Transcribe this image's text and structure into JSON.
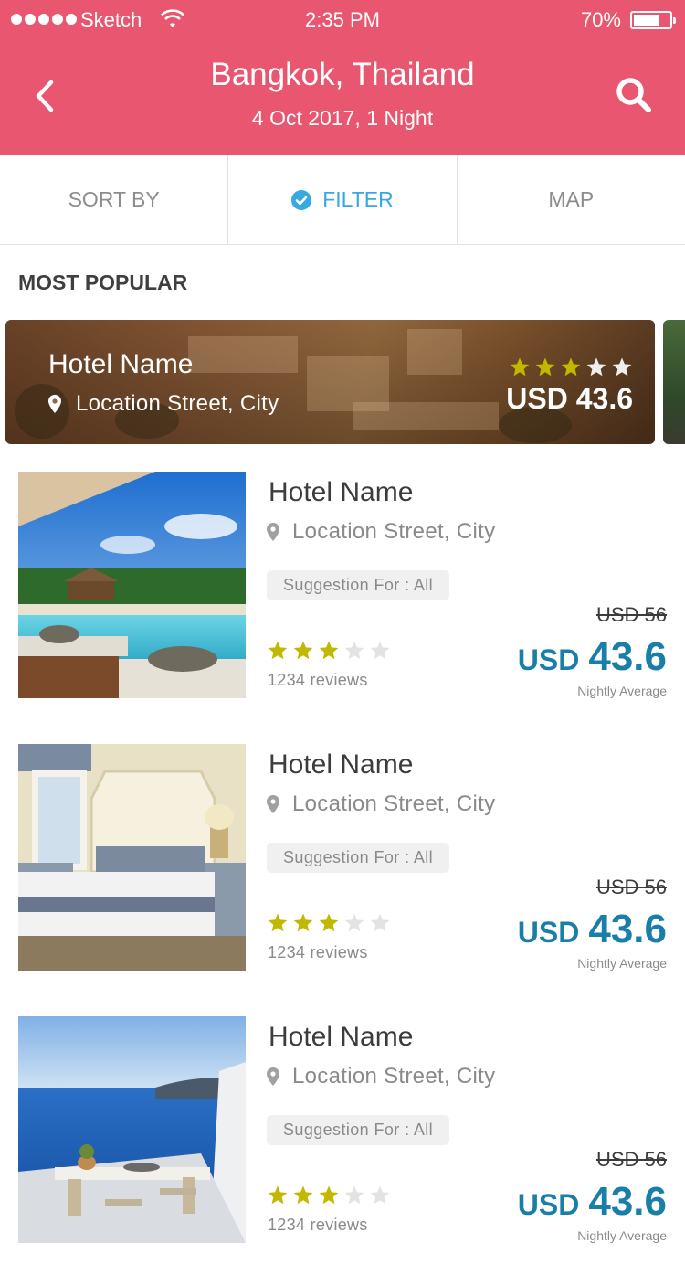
{
  "status_bar": {
    "carrier": "Sketch",
    "time": "2:35 PM",
    "battery": "70%",
    "battery_level": 0.7
  },
  "header": {
    "title": "Bangkok, Thailand",
    "subtitle": "4 Oct 2017, 1 Night",
    "back_icon": "chevron-left-icon",
    "search_icon": "search-icon"
  },
  "tabs": [
    {
      "label": "SORT BY",
      "active": false
    },
    {
      "label": "FILTER",
      "active": true,
      "icon": "check-circle-icon"
    },
    {
      "label": "MAP",
      "active": false
    }
  ],
  "section_title": "MOST POPULAR",
  "featured": {
    "name": "Hotel Name",
    "location": "Location Street, City",
    "rating": 3,
    "max_rating": 5,
    "price": "USD 43.6"
  },
  "hotels": [
    {
      "name": "Hotel Name",
      "location": "Location Street, City",
      "suggestion": "Suggestion For : All",
      "rating": 3,
      "max_rating": 5,
      "reviews": "1234 reviews",
      "old_price": "USD 56",
      "currency": "USD",
      "price": "43.6",
      "price_note": "Nightly Average",
      "image": "pool-resort-photo"
    },
    {
      "name": "Hotel Name",
      "location": "Location Street, City",
      "suggestion": "Suggestion For : All",
      "rating": 3,
      "max_rating": 5,
      "reviews": "1234 reviews",
      "old_price": "USD 56",
      "currency": "USD",
      "price": "43.6",
      "price_note": "Nightly Average",
      "image": "bedroom-photo"
    },
    {
      "name": "Hotel Name",
      "location": "Location Street, City",
      "suggestion": "Suggestion For : All",
      "rating": 3,
      "max_rating": 5,
      "reviews": "1234 reviews",
      "old_price": "USD 56",
      "currency": "USD",
      "price": "43.6",
      "price_note": "Nightly Average",
      "image": "sea-terrace-photo"
    }
  ],
  "colors": {
    "header": "#e8566f",
    "accent": "#37a8e0",
    "price": "#1a7fa8",
    "star_on": "#c2b800",
    "star_off": "#e3e3e3"
  }
}
